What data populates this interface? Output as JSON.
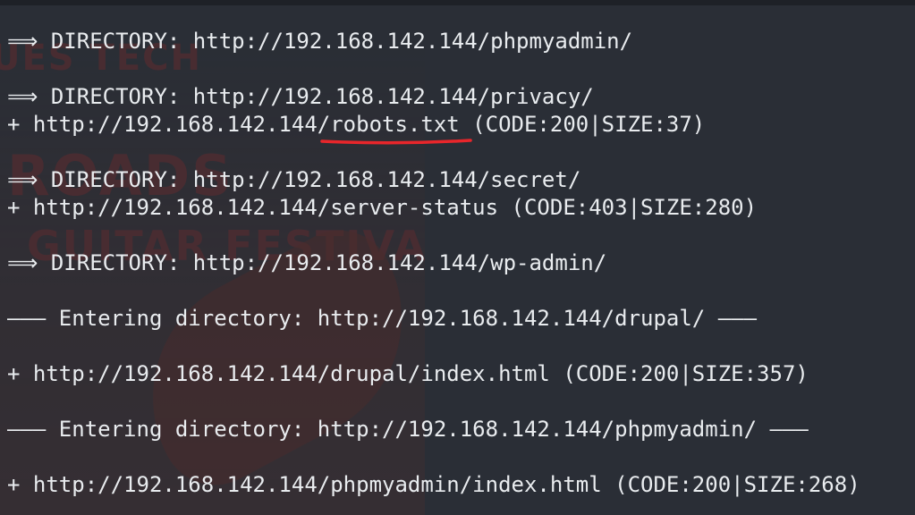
{
  "terminal": {
    "lines": [
      "⟹ DIRECTORY: http://192.168.142.144/phpmyadmin/",
      "⟹ DIRECTORY: http://192.168.142.144/privacy/",
      "+ http://192.168.142.144/robots.txt (CODE:200|SIZE:37)",
      "⟹ DIRECTORY: http://192.168.142.144/secret/",
      "+ http://192.168.142.144/server-status (CODE:403|SIZE:280)",
      "⟹ DIRECTORY: http://192.168.142.144/wp-admin/",
      "——— Entering directory: http://192.168.142.144/drupal/ ———",
      "+ http://192.168.142.144/drupal/index.html (CODE:200|SIZE:357)",
      "——— Entering directory: http://192.168.142.144/phpmyadmin/ ———",
      "+ http://192.168.142.144/phpmyadmin/index.html (CODE:200|SIZE:268)"
    ]
  },
  "background": {
    "text_1": "UES TECH",
    "text_2": "ROADS",
    "text_3": "GUITAR FESTIVAL"
  },
  "colors": {
    "background": "#2a2e36",
    "text": "#e9ecef",
    "annotation_underline": "#e8262b"
  }
}
